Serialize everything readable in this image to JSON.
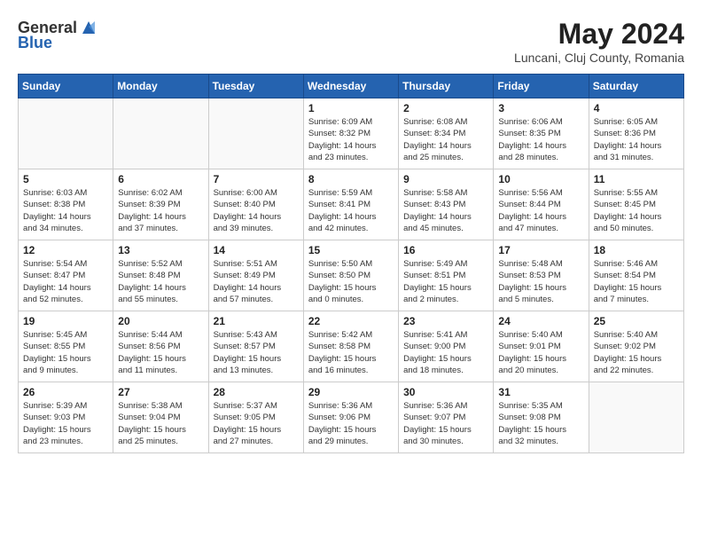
{
  "header": {
    "logo_general": "General",
    "logo_blue": "Blue",
    "month_year": "May 2024",
    "location": "Luncani, Cluj County, Romania"
  },
  "days_of_week": [
    "Sunday",
    "Monday",
    "Tuesday",
    "Wednesday",
    "Thursday",
    "Friday",
    "Saturday"
  ],
  "weeks": [
    [
      {
        "day": "",
        "info": ""
      },
      {
        "day": "",
        "info": ""
      },
      {
        "day": "",
        "info": ""
      },
      {
        "day": "1",
        "info": "Sunrise: 6:09 AM\nSunset: 8:32 PM\nDaylight: 14 hours\nand 23 minutes."
      },
      {
        "day": "2",
        "info": "Sunrise: 6:08 AM\nSunset: 8:34 PM\nDaylight: 14 hours\nand 25 minutes."
      },
      {
        "day": "3",
        "info": "Sunrise: 6:06 AM\nSunset: 8:35 PM\nDaylight: 14 hours\nand 28 minutes."
      },
      {
        "day": "4",
        "info": "Sunrise: 6:05 AM\nSunset: 8:36 PM\nDaylight: 14 hours\nand 31 minutes."
      }
    ],
    [
      {
        "day": "5",
        "info": "Sunrise: 6:03 AM\nSunset: 8:38 PM\nDaylight: 14 hours\nand 34 minutes."
      },
      {
        "day": "6",
        "info": "Sunrise: 6:02 AM\nSunset: 8:39 PM\nDaylight: 14 hours\nand 37 minutes."
      },
      {
        "day": "7",
        "info": "Sunrise: 6:00 AM\nSunset: 8:40 PM\nDaylight: 14 hours\nand 39 minutes."
      },
      {
        "day": "8",
        "info": "Sunrise: 5:59 AM\nSunset: 8:41 PM\nDaylight: 14 hours\nand 42 minutes."
      },
      {
        "day": "9",
        "info": "Sunrise: 5:58 AM\nSunset: 8:43 PM\nDaylight: 14 hours\nand 45 minutes."
      },
      {
        "day": "10",
        "info": "Sunrise: 5:56 AM\nSunset: 8:44 PM\nDaylight: 14 hours\nand 47 minutes."
      },
      {
        "day": "11",
        "info": "Sunrise: 5:55 AM\nSunset: 8:45 PM\nDaylight: 14 hours\nand 50 minutes."
      }
    ],
    [
      {
        "day": "12",
        "info": "Sunrise: 5:54 AM\nSunset: 8:47 PM\nDaylight: 14 hours\nand 52 minutes."
      },
      {
        "day": "13",
        "info": "Sunrise: 5:52 AM\nSunset: 8:48 PM\nDaylight: 14 hours\nand 55 minutes."
      },
      {
        "day": "14",
        "info": "Sunrise: 5:51 AM\nSunset: 8:49 PM\nDaylight: 14 hours\nand 57 minutes."
      },
      {
        "day": "15",
        "info": "Sunrise: 5:50 AM\nSunset: 8:50 PM\nDaylight: 15 hours\nand 0 minutes."
      },
      {
        "day": "16",
        "info": "Sunrise: 5:49 AM\nSunset: 8:51 PM\nDaylight: 15 hours\nand 2 minutes."
      },
      {
        "day": "17",
        "info": "Sunrise: 5:48 AM\nSunset: 8:53 PM\nDaylight: 15 hours\nand 5 minutes."
      },
      {
        "day": "18",
        "info": "Sunrise: 5:46 AM\nSunset: 8:54 PM\nDaylight: 15 hours\nand 7 minutes."
      }
    ],
    [
      {
        "day": "19",
        "info": "Sunrise: 5:45 AM\nSunset: 8:55 PM\nDaylight: 15 hours\nand 9 minutes."
      },
      {
        "day": "20",
        "info": "Sunrise: 5:44 AM\nSunset: 8:56 PM\nDaylight: 15 hours\nand 11 minutes."
      },
      {
        "day": "21",
        "info": "Sunrise: 5:43 AM\nSunset: 8:57 PM\nDaylight: 15 hours\nand 13 minutes."
      },
      {
        "day": "22",
        "info": "Sunrise: 5:42 AM\nSunset: 8:58 PM\nDaylight: 15 hours\nand 16 minutes."
      },
      {
        "day": "23",
        "info": "Sunrise: 5:41 AM\nSunset: 9:00 PM\nDaylight: 15 hours\nand 18 minutes."
      },
      {
        "day": "24",
        "info": "Sunrise: 5:40 AM\nSunset: 9:01 PM\nDaylight: 15 hours\nand 20 minutes."
      },
      {
        "day": "25",
        "info": "Sunrise: 5:40 AM\nSunset: 9:02 PM\nDaylight: 15 hours\nand 22 minutes."
      }
    ],
    [
      {
        "day": "26",
        "info": "Sunrise: 5:39 AM\nSunset: 9:03 PM\nDaylight: 15 hours\nand 23 minutes."
      },
      {
        "day": "27",
        "info": "Sunrise: 5:38 AM\nSunset: 9:04 PM\nDaylight: 15 hours\nand 25 minutes."
      },
      {
        "day": "28",
        "info": "Sunrise: 5:37 AM\nSunset: 9:05 PM\nDaylight: 15 hours\nand 27 minutes."
      },
      {
        "day": "29",
        "info": "Sunrise: 5:36 AM\nSunset: 9:06 PM\nDaylight: 15 hours\nand 29 minutes."
      },
      {
        "day": "30",
        "info": "Sunrise: 5:36 AM\nSunset: 9:07 PM\nDaylight: 15 hours\nand 30 minutes."
      },
      {
        "day": "31",
        "info": "Sunrise: 5:35 AM\nSunset: 9:08 PM\nDaylight: 15 hours\nand 32 minutes."
      },
      {
        "day": "",
        "info": ""
      }
    ]
  ]
}
